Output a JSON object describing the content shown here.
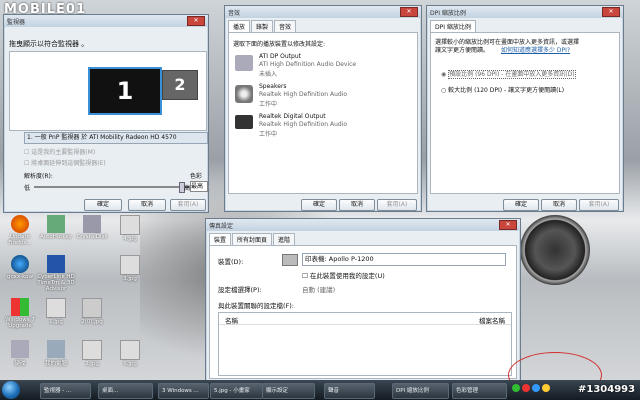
{
  "logo": {
    "text": "MOBILE01"
  },
  "watermark": "#1304993",
  "win1": {
    "title": "監視器",
    "heading": "拖曳顯示以符合監視器 。",
    "mon1": "1",
    "mon2": "2",
    "select": "1. 一般 PnP 監視器 於 ATI Mobility Radeon HD 4570",
    "chk1": "這是我的主要監視器(M)",
    "chk2": "將桌面延伸到這個監視器(E)",
    "res_label": "解析度(R):",
    "res_low": "低",
    "res_high": "高",
    "color_label": "色彩",
    "color_value": "最高",
    "ok": "確定",
    "cancel": "取消",
    "apply": "套用(A)"
  },
  "win2": {
    "title": "音效",
    "tabs": [
      "播放",
      "錄製",
      "音效"
    ],
    "heading": "選取下面的播放裝置以修改其設定:",
    "devices": [
      {
        "name": "ATI DP Output",
        "sub": "ATI High Definition Audio Device",
        "status": "未插入"
      },
      {
        "name": "Speakers",
        "sub": "Realtek High Definition Audio",
        "status": "工作中"
      },
      {
        "name": "Realtek Digital Output",
        "sub": "Realtek High Definition Audio",
        "status": "工作中"
      }
    ],
    "ok": "確定",
    "cancel": "取消",
    "apply": "套用(A)"
  },
  "win3": {
    "title": "DPI 縮放比例",
    "tab": "DPI 縮放比例",
    "desc1": "選擇較小的縮放比例可在畫面中放入更多資訊，或選擇",
    "desc2": "讓文字更方便閱讀。",
    "link": "如何知道應選擇多少 DPI?",
    "opt1": "預設比例 (96 DPI) - 在畫面中放入更多資訊(D)",
    "opt2": "較大比例 (120 DPI) - 讓文字更方便閱讀(L)",
    "ok": "確定",
    "cancel": "取消",
    "apply": "套用(A)"
  },
  "win4": {
    "title": "傳真設定",
    "tabs": [
      "裝置",
      "所有封面頁",
      "進階"
    ],
    "device_label": "裝置(D):",
    "device_value": "印表機: Apollo P-1200",
    "use_check": "在此裝置使用我的設定(U)",
    "profile_label": "設定檔選擇(P):",
    "profile_value": "自動 (建議)",
    "assoc_label": "與此裝置關聯的設定檔(F):",
    "col_name": "名稱",
    "col_file": "檔案名稱"
  },
  "desktop_icons": [
    {
      "label": "Update Firefox..."
    },
    {
      "label": "AutoHotkey"
    },
    {
      "label": "CrystalDisk"
    },
    {
      "label": "4.jpg"
    },
    {
      "label": "goxx-kow"
    },
    {
      "label": "CyberLink HD TimeTrn & 3D Advisor"
    },
    {
      "label": "3.jpg"
    },
    {
      "label": "Windows 7 Upgrade"
    },
    {
      "label": "1.jpg"
    },
    {
      "label": "2(0).jpg"
    },
    {
      "label": "硬碟"
    },
    {
      "label": "我的電腦"
    },
    {
      "label": "2.jpg"
    },
    {
      "label": "6.jpg"
    }
  ],
  "taskbar": [
    {
      "label": "監視器 - ..."
    },
    {
      "label": "桌面..."
    },
    {
      "label": "3 Windows ..."
    },
    {
      "label": "5.jpg - 小畫家"
    },
    {
      "label": "顯示設定"
    },
    {
      "label": "聲音"
    },
    {
      "label": "DPI 縮放比例"
    },
    {
      "label": "色彩管理"
    }
  ],
  "colors": {
    "accent": "#1d6fb8",
    "annotation": "#d33030"
  }
}
